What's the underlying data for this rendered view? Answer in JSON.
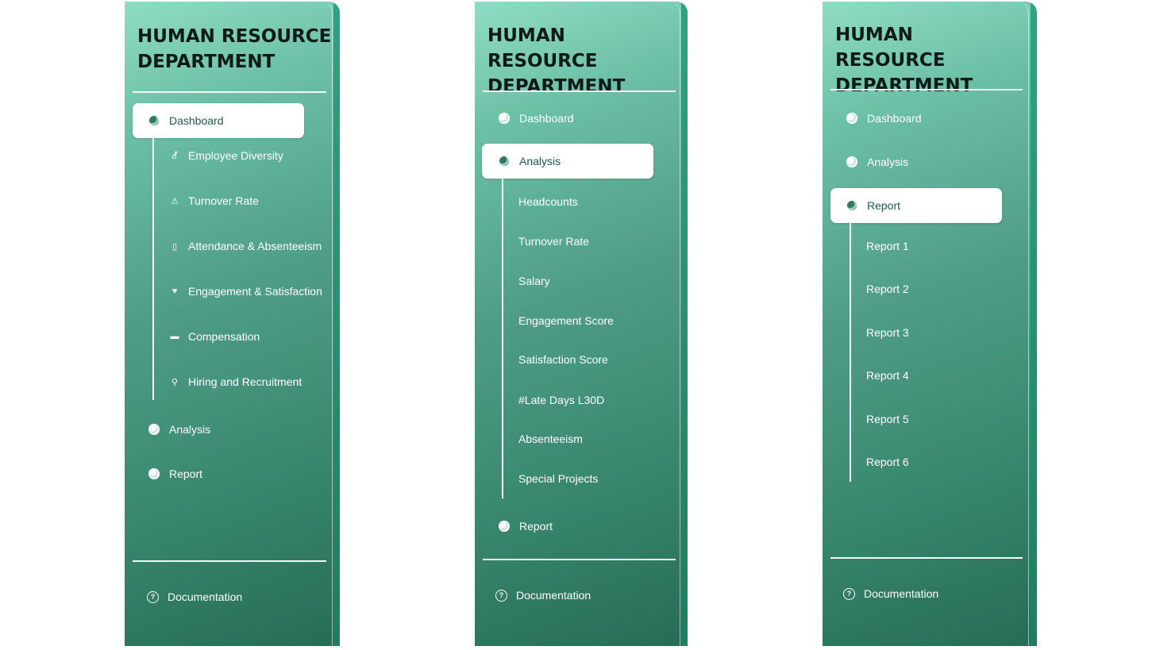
{
  "panels": [
    {
      "title_line1": "HUMAN RESOURCE",
      "title_line2": "DEPARTMENT",
      "nav": {
        "dashboard": "Dashboard",
        "analysis": "Analysis",
        "report": "Report"
      },
      "active": "Dashboard",
      "submenu": [
        {
          "label": "Employee Diversity",
          "icon": "gender-icon"
        },
        {
          "label": "Turnover Rate",
          "icon": "warning-icon"
        },
        {
          "label": "Attendance & Absenteeism",
          "icon": "calendar-icon"
        },
        {
          "label": "Engagement & Satisfaction",
          "icon": "heart-icon"
        },
        {
          "label": "Compensation",
          "icon": "card-icon"
        },
        {
          "label": "Hiring and Recruitment",
          "icon": "search-icon"
        }
      ],
      "documentation": "Documentation"
    },
    {
      "title_line1": "HUMAN RESOURCE",
      "title_line2": "DEPARTMENT",
      "nav": {
        "dashboard": "Dashboard",
        "analysis": "Analysis",
        "report": "Report"
      },
      "active": "Analysis",
      "submenu": [
        {
          "label": "Headcounts"
        },
        {
          "label": "Turnover Rate"
        },
        {
          "label": "Salary"
        },
        {
          "label": "Engagement Score"
        },
        {
          "label": "Satisfaction Score"
        },
        {
          "label": "#Late Days L30D"
        },
        {
          "label": "Absenteeism"
        },
        {
          "label": "Special Projects"
        }
      ],
      "documentation": "Documentation"
    },
    {
      "title_line1": "HUMAN RESOURCE",
      "title_line2": "DEPARTMENT",
      "nav": {
        "dashboard": "Dashboard",
        "analysis": "Analysis",
        "report": "Report"
      },
      "active": "Report",
      "submenu": [
        {
          "label": "Report 1"
        },
        {
          "label": "Report 2"
        },
        {
          "label": "Report 3"
        },
        {
          "label": "Report 4"
        },
        {
          "label": "Report 5"
        },
        {
          "label": "Report 6"
        }
      ],
      "documentation": "Documentation"
    }
  ],
  "colors": {
    "accent": "#3a8a70",
    "active_text": "#1a5c4a",
    "title": "#0e1a17"
  },
  "icons": {
    "nav": "globe-icon",
    "documentation": "help-circle-icon"
  }
}
